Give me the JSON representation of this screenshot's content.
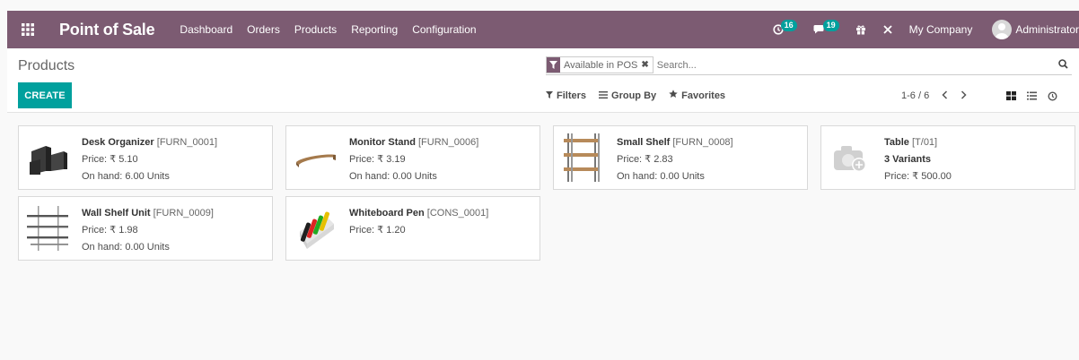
{
  "navbar": {
    "app_title": "Point of Sale",
    "menu": [
      "Dashboard",
      "Orders",
      "Products",
      "Reporting",
      "Configuration"
    ],
    "activity_count": "16",
    "messages_count": "19",
    "company": "My Company",
    "user": "Administrator",
    "color": "#7c5b72"
  },
  "control_panel": {
    "breadcrumb": "Products",
    "create_label": "CREATE",
    "search": {
      "facet": "Available in POS",
      "placeholder": "Search..."
    },
    "filters_label": "Filters",
    "groupby_label": "Group By",
    "favorites_label": "Favorites",
    "pager": "1-6 / 6"
  },
  "products": [
    {
      "name": "Desk Organizer",
      "ref": "[FURN_0001]",
      "price": "Price: ₹ 5.10",
      "onhand": "On hand: 6.00 Units",
      "image": "desk-organizer"
    },
    {
      "name": "Monitor Stand",
      "ref": "[FURN_0006]",
      "price": "Price: ₹ 3.19",
      "onhand": "On hand: 0.00 Units",
      "image": "monitor-stand"
    },
    {
      "name": "Small Shelf",
      "ref": "[FURN_0008]",
      "price": "Price: ₹ 2.83",
      "onhand": "On hand: 0.00 Units",
      "image": "small-shelf"
    },
    {
      "name": "Table",
      "ref": "[T/01]",
      "variants": "3 Variants",
      "price": "Price: ₹ 500.00",
      "image": "camera-placeholder"
    },
    {
      "name": "Wall Shelf Unit",
      "ref": "[FURN_0009]",
      "price": "Price: ₹ 1.98",
      "onhand": "On hand: 0.00 Units",
      "image": "wall-shelf"
    },
    {
      "name": "Whiteboard Pen",
      "ref": "[CONS_0001]",
      "price": "Price: ₹ 1.20",
      "image": "whiteboard-pen"
    }
  ],
  "accent": "#00a09d"
}
